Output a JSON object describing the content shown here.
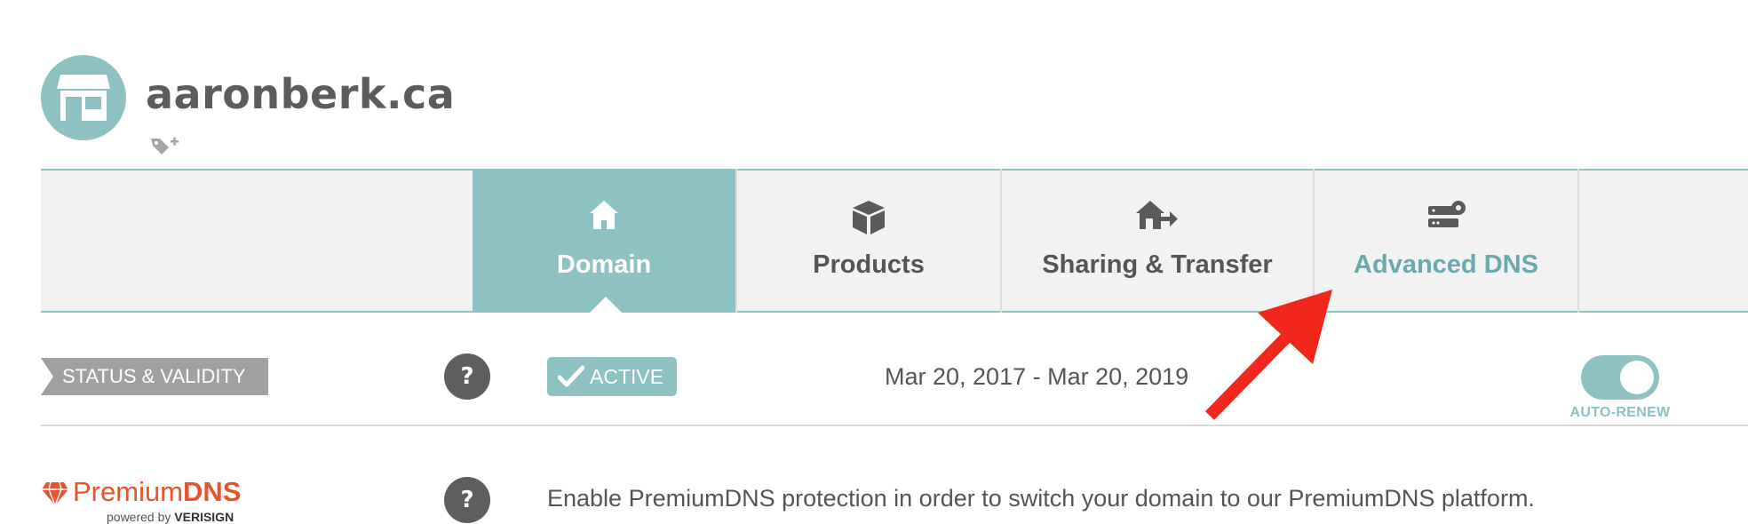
{
  "header": {
    "domain_name": "aaronberk.ca",
    "avatar_icon": "storefront-icon",
    "tag_icon": "add-tag-icon"
  },
  "tabs": [
    {
      "label": "Domain",
      "icon": "home-icon",
      "active": true
    },
    {
      "label": "Products",
      "icon": "box-icon",
      "active": false
    },
    {
      "label": "Sharing & Transfer",
      "icon": "house-arrow-icon",
      "active": false
    },
    {
      "label": "Advanced DNS",
      "icon": "server-gear-icon",
      "active": false
    }
  ],
  "status": {
    "label": "STATUS & VALIDITY",
    "help": "?",
    "badge": "ACTIVE",
    "date_range": "Mar 20, 2017 - Mar 20, 2019",
    "toggle_label": "AUTO-RENEW",
    "toggle_on": true
  },
  "premium_dns": {
    "logo_prefix": "Premium",
    "logo_suffix": "DNS",
    "powered_by": "powered by",
    "powered_brand": "VERISIGN",
    "help": "?",
    "description": "Enable PremiumDNS protection in order to switch your domain to our PremiumDNS platform."
  },
  "colors": {
    "accent": "#8ec1c1",
    "premium": "#e8532b",
    "arrow": "#f2271c"
  }
}
